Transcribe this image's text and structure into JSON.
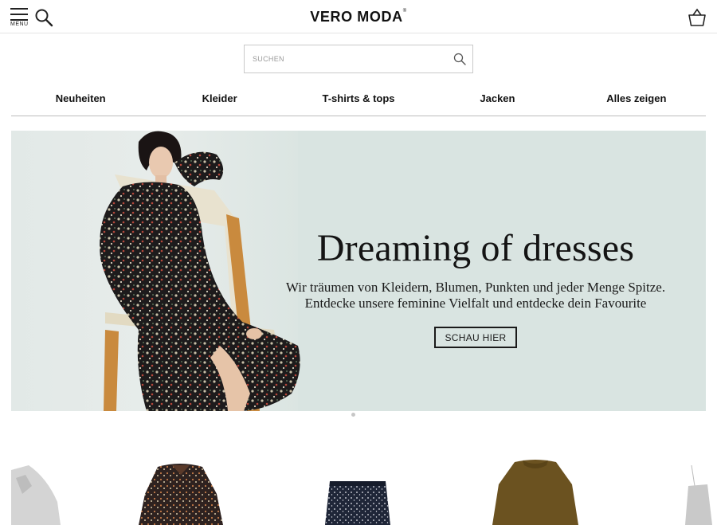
{
  "header": {
    "menu_label": "MENU",
    "logo_text": "VERO MODA",
    "logo_mark": "®",
    "icons": {
      "menu": "hamburger-icon",
      "search": "search-icon",
      "basket": "basket-icon"
    }
  },
  "search": {
    "placeholder": "SUCHEN",
    "value": ""
  },
  "categories": [
    "Neuheiten",
    "Kleider",
    "T-shirts & tops",
    "Jacken",
    "Alles zeigen"
  ],
  "hero": {
    "title": "Dreaming of dresses",
    "subtitle_line1": "Wir träumen von Kleidern, Blumen, Punkten und jeder Menge Spitze.",
    "subtitle_line2": "Entdecke unsere feminine Vielfalt und entdecke dein Favourite",
    "cta_label": "SCHAU HIER",
    "background_color": "#d9e4e1"
  },
  "carousel": {
    "slides": 1,
    "active": 1
  },
  "products": [
    {
      "name": "grey lace top",
      "color": "#c9c9c9"
    },
    {
      "name": "floral print blouse",
      "color": "#3b2a24"
    },
    {
      "name": "navy dotted skirt",
      "color": "#1f2638"
    },
    {
      "name": "olive knit sweater",
      "color": "#6b5220"
    },
    {
      "name": "grey lace cami",
      "color": "#bdbdbd"
    }
  ]
}
